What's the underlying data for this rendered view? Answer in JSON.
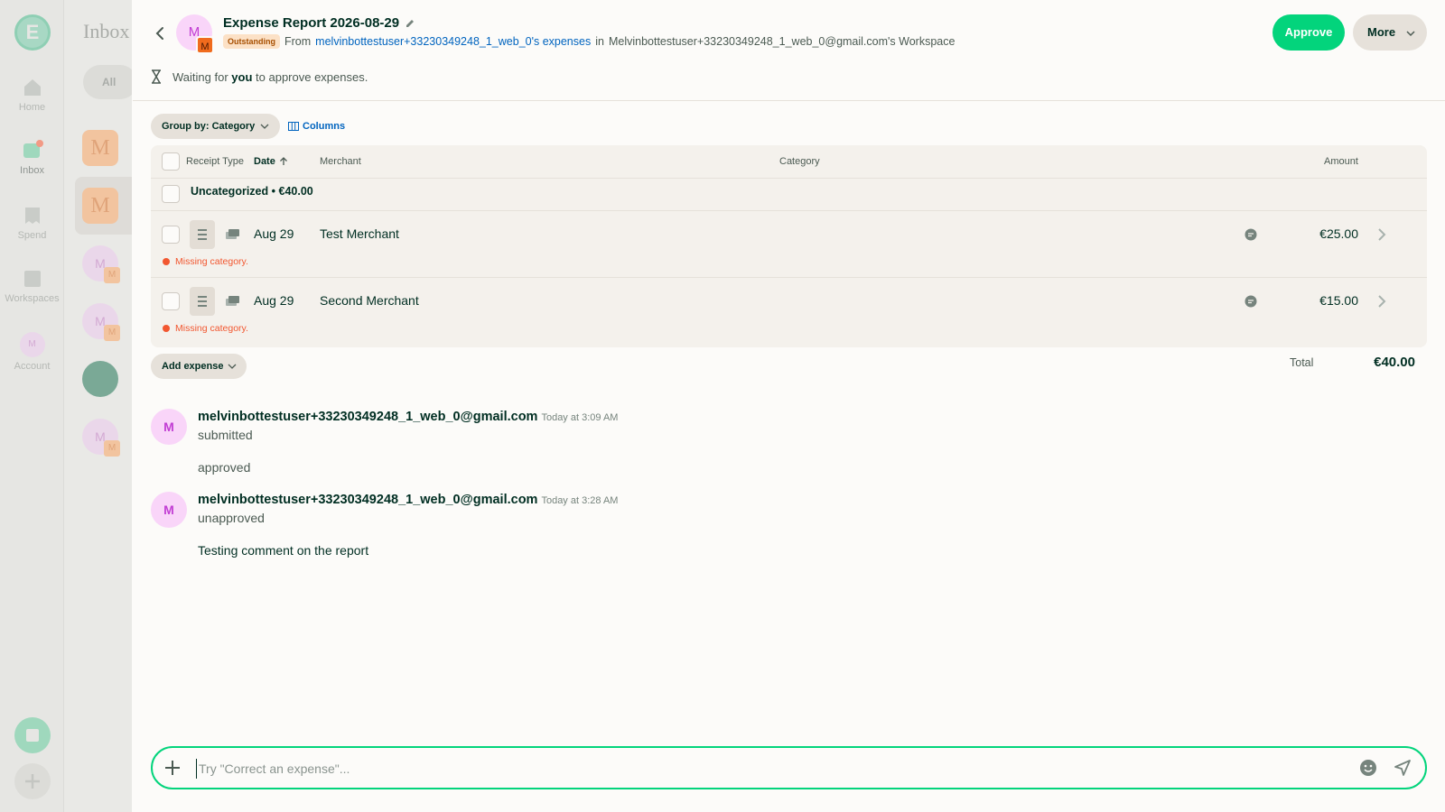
{
  "nav": {
    "items": [
      {
        "label": "Home"
      },
      {
        "label": "Inbox"
      },
      {
        "label": "Spend"
      },
      {
        "label": "Workspaces"
      },
      {
        "label": "Account"
      }
    ],
    "logo_letter": "E",
    "account_initial": "M"
  },
  "inbox": {
    "title": "Inbox",
    "filter_chip": "All",
    "rows": [
      "M",
      "M",
      "M",
      "M",
      "",
      "M"
    ]
  },
  "report": {
    "avatar_initial": "M",
    "avatar_sub_initial": "M",
    "title": "Expense Report 2026-08-29",
    "status_badge": "Outstanding",
    "from_prefix": "From",
    "from_link": "melvinbottestuser+33230349248_1_web_0's expenses",
    "in_text": "in",
    "workspace": "Melvinbottestuser+33230349248_1_web_0@gmail.com's Workspace",
    "approve_label": "Approve",
    "more_label": "More",
    "waiting_prefix": "Waiting for",
    "waiting_bold": "you",
    "waiting_suffix": "to approve expenses."
  },
  "toolbar": {
    "group_by_label": "Group by: Category",
    "columns_label": "Columns"
  },
  "table": {
    "headers": {
      "receipt_type": "Receipt Type",
      "date": "Date",
      "merchant": "Merchant",
      "category": "Category",
      "amount": "Amount"
    },
    "group": {
      "label": "Uncategorized",
      "separator": "•",
      "total": "€40.00"
    },
    "rows": [
      {
        "date": "Aug 29",
        "merchant": "Test Merchant",
        "amount": "€25.00",
        "error": "Missing category."
      },
      {
        "date": "Aug 29",
        "merchant": "Second Merchant",
        "amount": "€15.00",
        "error": "Missing category."
      }
    ]
  },
  "footer": {
    "add_expense_label": "Add expense",
    "total_label": "Total",
    "total_value": "€40.00"
  },
  "activity": [
    {
      "initial": "M",
      "name": "melvinbottestuser+33230349248_1_web_0@gmail.com",
      "time": "Today at 3:09 AM",
      "lines": [
        "submitted",
        "approved"
      ]
    },
    {
      "initial": "M",
      "name": "melvinbottestuser+33230349248_1_web_0@gmail.com",
      "time": "Today at 3:28 AM",
      "lines": [
        "unapproved",
        "Testing comment on the report"
      ]
    }
  ],
  "composer": {
    "placeholder": "Try \"Correct an expense\"...",
    "value": ""
  },
  "colors": {
    "accent_green": "#03d47c",
    "link_blue": "#0164bf",
    "error_red": "#f25730",
    "badge_bg": "#fce1c6",
    "badge_text": "#a74f00",
    "text_primary": "#002e22"
  },
  "icons": [
    "back-icon",
    "pencil-icon",
    "hourglass-icon",
    "columns-icon",
    "sort-up-icon",
    "receipt-icon",
    "cash-icon",
    "chat-bubble-icon",
    "chevron-right-icon",
    "plus-icon",
    "emoji-icon",
    "send-icon"
  ]
}
